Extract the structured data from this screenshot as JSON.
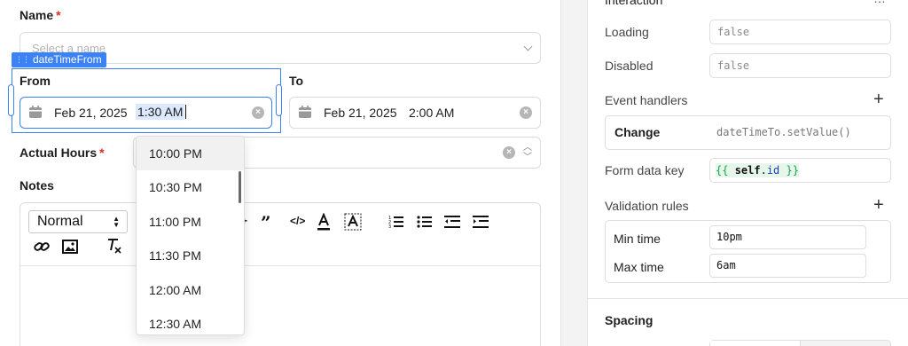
{
  "form": {
    "name": {
      "label": "Name",
      "required_mark": "*",
      "placeholder": "Select a name"
    },
    "component_tag": "dateTimeFrom",
    "from": {
      "label": "From",
      "date": "Feb 21, 2025",
      "time": "1:30 AM"
    },
    "to": {
      "label": "To",
      "date": "Feb 21, 2025",
      "time": "2:00 AM"
    },
    "actual_hours": {
      "label": "Actual Hours",
      "required_mark": "*"
    },
    "notes": {
      "label": "Notes",
      "format_select": "Normal",
      "toolbar_icons": [
        "quote-icon",
        "code-icon",
        "text-color-icon",
        "highlight-icon",
        "ordered-list-icon",
        "bullet-list-icon",
        "outdent-icon",
        "indent-icon",
        "link-icon",
        "image-icon",
        "clear-format-icon"
      ]
    },
    "time_options": [
      "10:00 PM",
      "10:30 PM",
      "11:00 PM",
      "11:30 PM",
      "12:00 AM",
      "12:30 AM"
    ],
    "highlighted_option": "10:00 PM"
  },
  "inspector": {
    "section_title": "Interaction",
    "loading": {
      "label": "Loading",
      "value": "false"
    },
    "disabled": {
      "label": "Disabled",
      "value": "false"
    },
    "event_handlers": {
      "label": "Event handlers",
      "event": "Change",
      "action": "dateTimeTo.setValue()"
    },
    "form_data_key": {
      "label": "Form data key",
      "open": "{{",
      "token1": "self",
      "dot": ".",
      "token2": "id",
      "close": "}}"
    },
    "validation": {
      "label": "Validation rules",
      "min_time": {
        "label": "Min time",
        "value": "10pm"
      },
      "max_time": {
        "label": "Max time",
        "value": "6am"
      }
    },
    "spacing": {
      "label": "Spacing"
    }
  },
  "colors": {
    "accent": "#3b82f6",
    "required": "#d92d20",
    "code_green": "#16a34a",
    "code_blue": "#1e40af"
  }
}
